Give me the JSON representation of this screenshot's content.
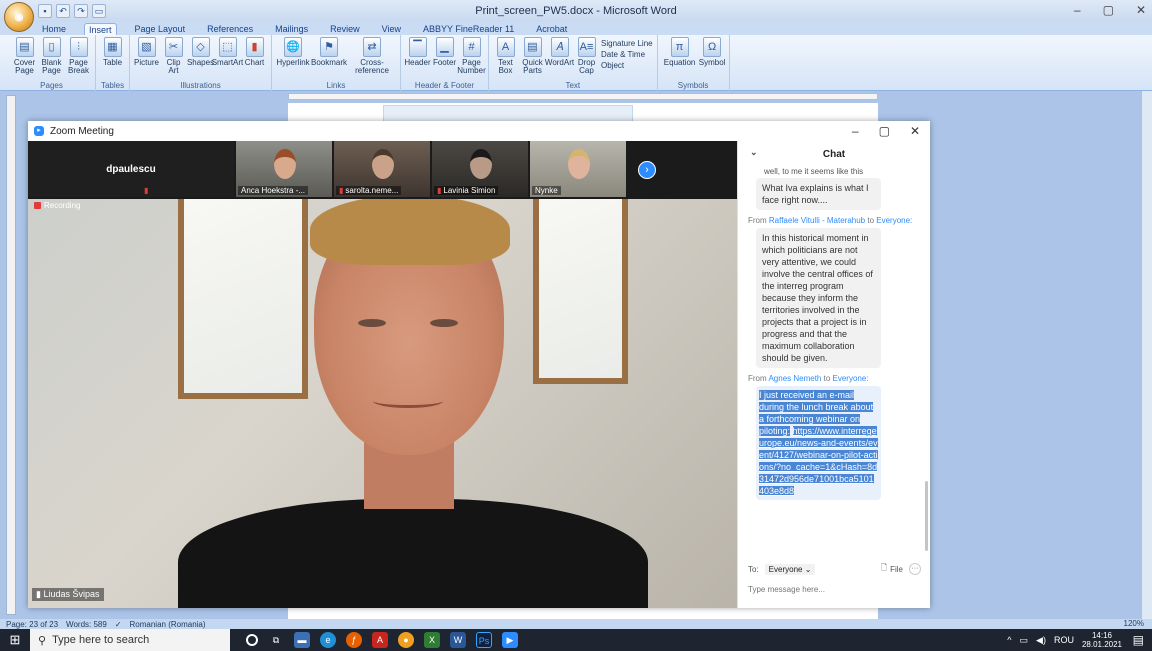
{
  "word": {
    "title": "Print_screen_PW5.docx - Microsoft Word",
    "tabs": [
      "Home",
      "Insert",
      "Page Layout",
      "References",
      "Mailings",
      "Review",
      "View",
      "ABBYY FineReader 11",
      "Acrobat"
    ],
    "active_tab": "Insert",
    "groups": {
      "pages": {
        "label": "Pages",
        "items": [
          "Cover Page",
          "Blank Page",
          "Page Break"
        ]
      },
      "tables": {
        "label": "Tables",
        "items": [
          "Table"
        ]
      },
      "illustrations": {
        "label": "Illustrations",
        "items": [
          "Picture",
          "Clip Art",
          "Shapes",
          "SmartArt",
          "Chart"
        ]
      },
      "links": {
        "label": "Links",
        "items": [
          "Hyperlink",
          "Bookmark",
          "Cross-reference"
        ]
      },
      "header_footer": {
        "label": "Header & Footer",
        "items": [
          "Header",
          "Footer",
          "Page Number"
        ]
      },
      "text": {
        "label": "Text",
        "items": [
          "Text Box",
          "Quick Parts",
          "WordArt",
          "Drop Cap"
        ],
        "stack": [
          "Signature Line",
          "Date & Time",
          "Object"
        ]
      },
      "symbols": {
        "label": "Symbols",
        "items": [
          "Equation",
          "Symbol"
        ]
      }
    },
    "status": {
      "page": "Page: 23 of 23",
      "words": "Words: 589",
      "language": "Romanian (Romania)",
      "zoom": "120%"
    }
  },
  "taskbar": {
    "search_placeholder": "Type here to search",
    "lang": "ROU",
    "time": "14:16",
    "date": "28.01.2021"
  },
  "zoom": {
    "title": "Zoom Meeting",
    "recording": "Recording",
    "speaker": "Liudas Švipas",
    "participants": [
      {
        "name": "dpaulescu",
        "type": "text"
      },
      {
        "name": "Anca Hoekstra -..."
      },
      {
        "name": "sarolta.neme..."
      },
      {
        "name": "Lavinia Simion"
      },
      {
        "name": "Nynke"
      }
    ],
    "chat": {
      "title": "Chat",
      "cut_line": "well, to me it seems like this",
      "messages": [
        {
          "text": "What Iva explains is what I face right now...."
        },
        {
          "from_label": "From",
          "from": "Raffaele Vitulli - Materahub",
          "to_label": "to",
          "to": "Everyone:",
          "text": "In this historical moment in which politicians are not very attentive, we could involve the central offices of the interreg program because they inform the territories involved in the projects that a project is in progress and that the maximum collaboration should be given."
        },
        {
          "from_label": "From",
          "from": "Agnes Nemeth",
          "to_label": "to",
          "to": "Everyone:",
          "text": "I just received an e-mail during the lunch break about a forthcoming webinar on piloting:",
          "link": "https://www.interregeurope.eu/news-and-events/event/4127/webinar-on-pilot-actions/?no_cache=1&cHash=8d31472d956de71001bca5101403e8d8"
        }
      ],
      "to_label": "To:",
      "to_value": "Everyone",
      "file_label": "File",
      "input_placeholder": "Type message here..."
    }
  }
}
